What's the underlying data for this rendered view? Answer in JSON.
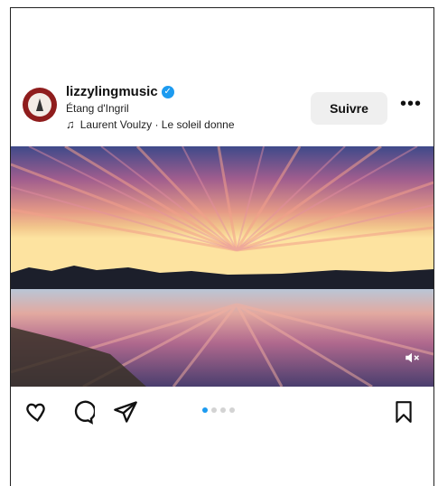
{
  "post": {
    "username": "lizzylingmusic",
    "verified": true,
    "location": "Étang d'Ingril",
    "music": "Laurent Voulzy · Le soleil donne",
    "follow_label": "Suivre",
    "more_label": "•••",
    "carousel": {
      "total": 4,
      "active": 1
    },
    "audio_muted": true
  },
  "colors": {
    "accent": "#1d9bf0",
    "follow_bg": "#efefef",
    "avatar_ring": "#8f1d1d"
  },
  "icons": {
    "like": "heart-outline-icon",
    "comment": "comment-bubble-icon",
    "share": "paper-plane-icon",
    "save": "bookmark-outline-icon",
    "mute": "speaker-muted-icon",
    "music": "music-note-icon",
    "verified": "verified-badge-icon"
  }
}
